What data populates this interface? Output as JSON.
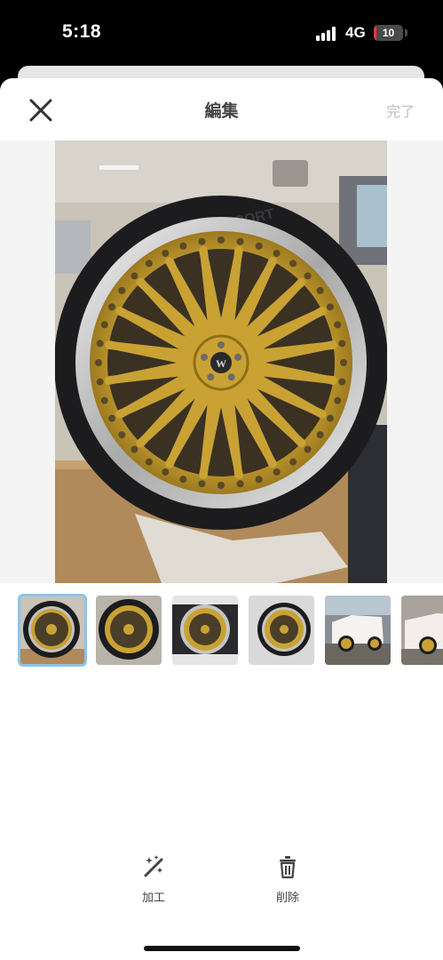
{
  "status_bar": {
    "time": "5:18",
    "network": "4G",
    "battery": "10",
    "battery_level_percent": 10,
    "battery_color": "#e23b30"
  },
  "nav": {
    "title": "編集",
    "done_label": "完了",
    "close_icon": "close-icon"
  },
  "preview": {
    "tire_text": "BOUNDS SPORT"
  },
  "thumbnails": [
    {
      "selected": true
    },
    {
      "selected": false
    },
    {
      "selected": false
    },
    {
      "selected": false
    },
    {
      "selected": false
    },
    {
      "selected": false
    }
  ],
  "toolbar": {
    "edit_label": "加工",
    "edit_icon": "magic-wand-icon",
    "delete_label": "削除",
    "delete_icon": "trash-icon"
  },
  "colors": {
    "selection": "#8cc4ea",
    "wheel_gold": "#c9a233",
    "done_disabled": "#bdbdbd"
  }
}
